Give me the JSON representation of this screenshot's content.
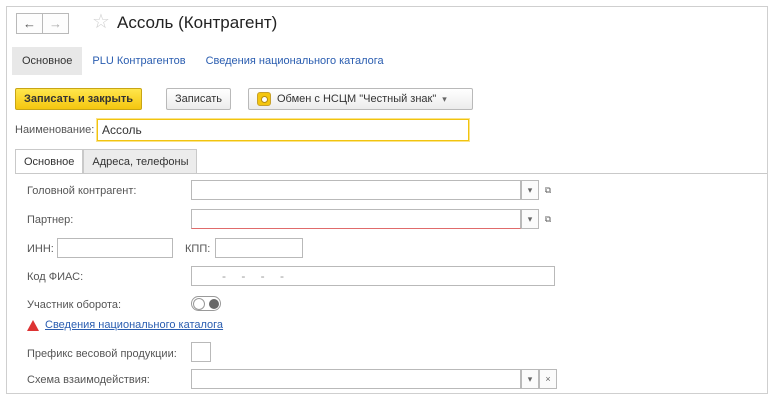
{
  "header": {
    "back_glyph": "←",
    "forward_glyph": "→",
    "star_glyph": "☆",
    "title": "Ассоль (Контрагент)"
  },
  "panel_tabs": [
    "Основное",
    "PLU Контрагентов",
    "Сведения национального каталога"
  ],
  "toolbar": {
    "save_close": "Записать и закрыть",
    "save": "Записать",
    "exchange": "Обмен с НСЦМ \"Честный знак\"",
    "dropdown_glyph": "▾"
  },
  "name_field": {
    "label": "Наименование:",
    "value": "Ассоль"
  },
  "form_tabs": [
    "Основное",
    "Адреса, телефоны"
  ],
  "fields": {
    "head_counterparty": {
      "label": "Головной контрагент:",
      "value": ""
    },
    "partner": {
      "label": "Партнер:",
      "value": ""
    },
    "inn": {
      "label": "ИНН:",
      "value": ""
    },
    "kpp": {
      "label": "КПП:",
      "value": ""
    },
    "fias": {
      "label": "Код ФИАС:",
      "mask": "- - - -"
    },
    "participant": {
      "label": "Участник оборота:"
    },
    "national_catalog_link": "Сведения национального каталога",
    "weight_prefix": {
      "label": "Префикс весовой продукции:",
      "value": ""
    },
    "interaction_scheme": {
      "label": "Схема взаимодействия:",
      "value": ""
    }
  },
  "glyphs": {
    "open": "⧉",
    "clear": "×",
    "arrow": "▾"
  },
  "colors": {
    "accent_yellow": "#f4c60f",
    "link": "#2a5db0",
    "warning": "#d33333"
  }
}
